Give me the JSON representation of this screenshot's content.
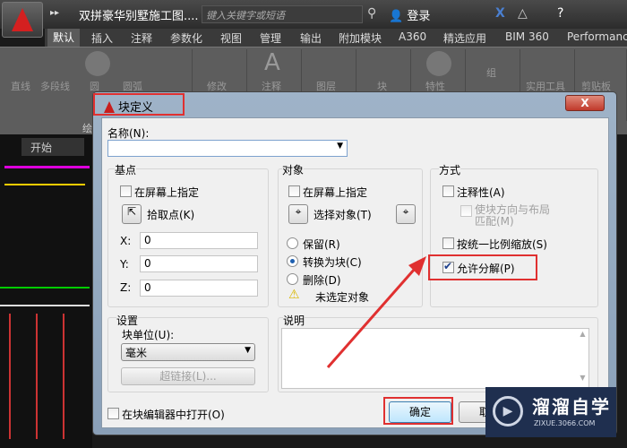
{
  "app": {
    "document_title": "双拼豪华别墅施工图....",
    "search_placeholder": "键入关键字或短语",
    "login": "登录"
  },
  "ribbon": {
    "tabs": [
      "默认",
      "插入",
      "注释",
      "参数化",
      "视图",
      "管理",
      "输出",
      "附加模块",
      "A360",
      "精选应用",
      "BIM 360",
      "Performance"
    ],
    "tools": [
      "直线",
      "多段线",
      "圆",
      "圆弧",
      "修改",
      "注释",
      "图层",
      "块",
      "特性",
      "组",
      "实用工具",
      "剪贴板"
    ],
    "panel_label": "绘"
  },
  "drawing": {
    "tab": "开始"
  },
  "dialog": {
    "title": "块定义",
    "close": "X",
    "name_label": "名称(N):",
    "name_value": "",
    "base_point": {
      "title": "基点",
      "specify_on_screen": "在屏幕上指定",
      "pick_point": "拾取点(K)",
      "x_label": "X:",
      "y_label": "Y:",
      "z_label": "Z:",
      "x": "0",
      "y": "0",
      "z": "0"
    },
    "objects": {
      "title": "对象",
      "specify_on_screen": "在屏幕上指定",
      "select_objects": "选择对象(T)",
      "retain": "保留(R)",
      "convert": "转换为块(C)",
      "delete": "删除(D)",
      "warning": "未选定对象"
    },
    "behavior": {
      "title": "方式",
      "annotative": "注释性(A)",
      "match_orientation": "使块方向与布局匹配(M)",
      "scale_uniformly": "按统一比例缩放(S)",
      "allow_explode": "允许分解(P)",
      "allow_explode_checked": true
    },
    "settings": {
      "title": "设置",
      "unit_label": "块单位(U):",
      "unit_value": "毫米",
      "hyperlink": "超链接(L)..."
    },
    "description": {
      "title": "说明",
      "value": ""
    },
    "open_in_editor": "在块编辑器中打开(O)",
    "ok": "确定",
    "cancel": "取消"
  },
  "watermark": {
    "name": "溜溜自学",
    "url": "ZIXUE.3066.COM"
  },
  "colors": {
    "highlight": "#e03030",
    "accent": "#1d5fb0"
  }
}
